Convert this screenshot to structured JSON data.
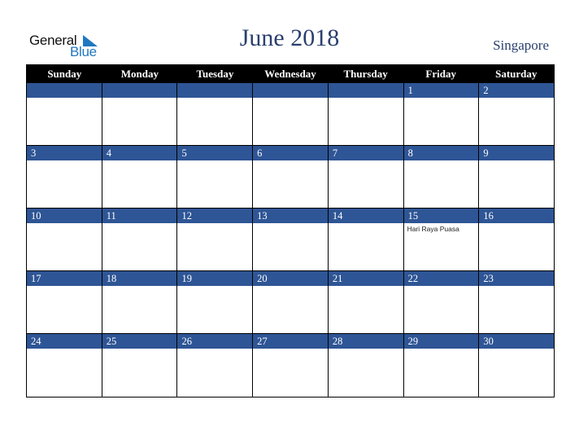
{
  "logo": {
    "general": "General",
    "blue": "Blue"
  },
  "title": "June 2018",
  "country": "Singapore",
  "weekdays": [
    "Sunday",
    "Monday",
    "Tuesday",
    "Wednesday",
    "Thursday",
    "Friday",
    "Saturday"
  ],
  "weeks": [
    [
      {
        "day": ""
      },
      {
        "day": ""
      },
      {
        "day": ""
      },
      {
        "day": ""
      },
      {
        "day": ""
      },
      {
        "day": "1"
      },
      {
        "day": "2"
      }
    ],
    [
      {
        "day": "3"
      },
      {
        "day": "4"
      },
      {
        "day": "5"
      },
      {
        "day": "6"
      },
      {
        "day": "7"
      },
      {
        "day": "8"
      },
      {
        "day": "9"
      }
    ],
    [
      {
        "day": "10"
      },
      {
        "day": "11"
      },
      {
        "day": "12"
      },
      {
        "day": "13"
      },
      {
        "day": "14"
      },
      {
        "day": "15",
        "event": "Hari Raya Puasa"
      },
      {
        "day": "16"
      }
    ],
    [
      {
        "day": "17"
      },
      {
        "day": "18"
      },
      {
        "day": "19"
      },
      {
        "day": "20"
      },
      {
        "day": "21"
      },
      {
        "day": "22"
      },
      {
        "day": "23"
      }
    ],
    [
      {
        "day": "24"
      },
      {
        "day": "25"
      },
      {
        "day": "26"
      },
      {
        "day": "27"
      },
      {
        "day": "28"
      },
      {
        "day": "29"
      },
      {
        "day": "30"
      }
    ]
  ],
  "colors": {
    "header_bg": "#000000",
    "date_bar": "#2e5595",
    "title": "#2a3f6e",
    "logo_blue": "#1f78c1"
  }
}
